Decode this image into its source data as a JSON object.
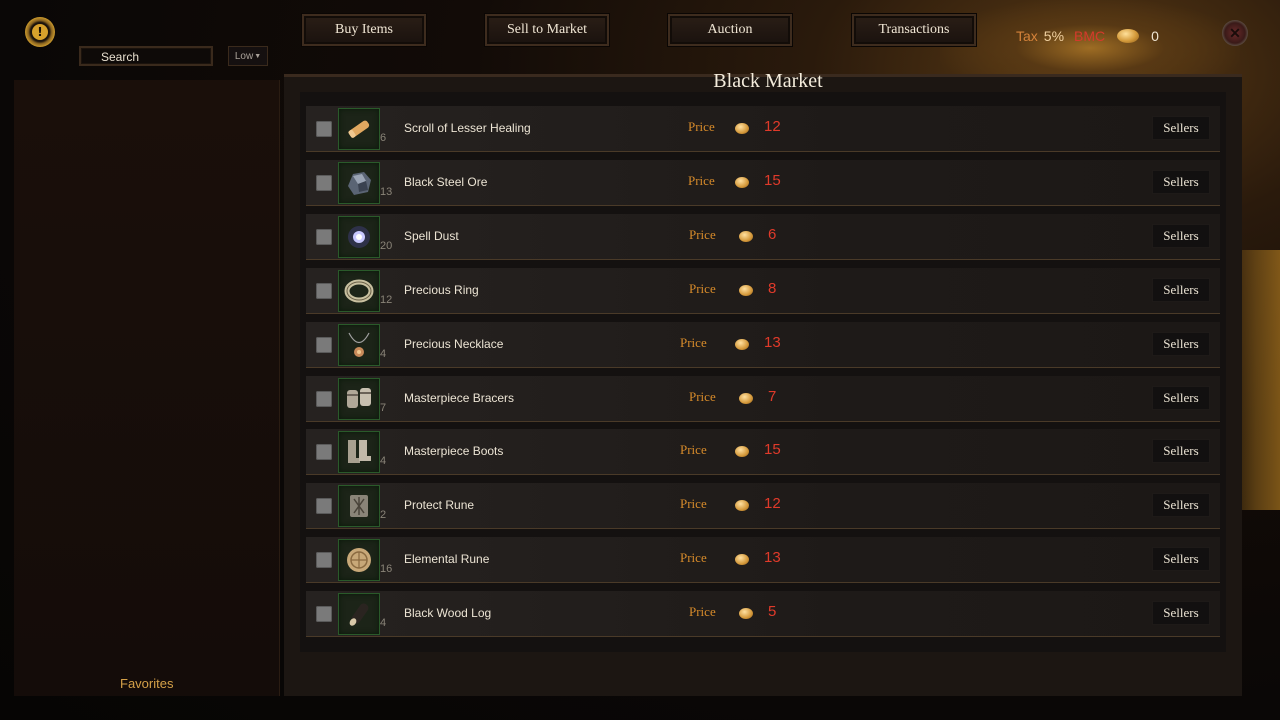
{
  "toolbar": {
    "search_placeholder": "Search",
    "sort_value": "Low"
  },
  "tabs": [
    {
      "label": "Buy Items"
    },
    {
      "label": "Sell to Market"
    },
    {
      "label": "Auction"
    },
    {
      "label": "Transactions"
    }
  ],
  "currency": {
    "tax_label": "Tax",
    "tax_value": "5%",
    "bmc_label": "BMC",
    "bmc_value": "0"
  },
  "market": {
    "title": "Black Market",
    "price_label": "Price",
    "sellers_label": "Sellers",
    "items": [
      {
        "name": "Scroll of Lesser Healing",
        "qty": "6",
        "price": "12",
        "icon": "scroll-icon"
      },
      {
        "name": "Black Steel Ore",
        "qty": "13",
        "price": "15",
        "icon": "ore-icon"
      },
      {
        "name": "Spell Dust",
        "qty": "20",
        "price": "6",
        "icon": "dust-icon"
      },
      {
        "name": "Precious Ring",
        "qty": "12",
        "price": "8",
        "icon": "ring-icon"
      },
      {
        "name": "Precious Necklace",
        "qty": "4",
        "price": "13",
        "icon": "necklace-icon"
      },
      {
        "name": "Masterpiece Bracers",
        "qty": "7",
        "price": "7",
        "icon": "bracers-icon"
      },
      {
        "name": "Masterpiece Boots",
        "qty": "4",
        "price": "15",
        "icon": "boots-icon"
      },
      {
        "name": "Protect Rune",
        "qty": "2",
        "price": "12",
        "icon": "rune-icon"
      },
      {
        "name": "Elemental Rune",
        "qty": "16",
        "price": "13",
        "icon": "elemental-rune-icon"
      },
      {
        "name": "Black Wood Log",
        "qty": "4",
        "price": "5",
        "icon": "log-icon"
      }
    ]
  },
  "sidebar": {
    "favorites_label": "Favorites"
  },
  "colors": {
    "price_label": "#d68a2a",
    "price_value": "#e03a2a",
    "accent_gold": "#d4a048"
  }
}
